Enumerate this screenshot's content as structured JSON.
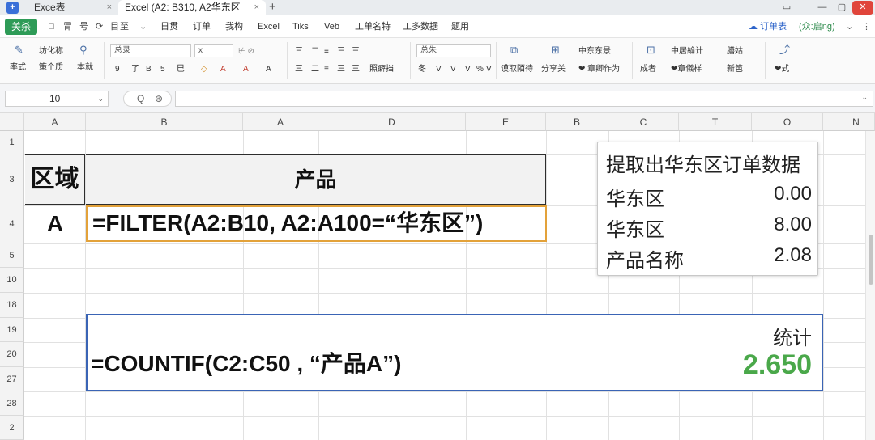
{
  "titlebar": {
    "logo": "+",
    "tabs": [
      {
        "label": "Exce表",
        "close": "×"
      },
      {
        "label": "Excel (A2: B310, A2华东区",
        "close": "×"
      }
    ],
    "new_tab": "+",
    "controls": [
      "▭",
      "—",
      "▢",
      "✕"
    ]
  },
  "menubar": {
    "start_label": "关杀",
    "quick_icons": [
      "□",
      "冐",
      "号",
      "⟳",
      "目",
      "至"
    ],
    "items": [
      "日贯",
      "订单",
      "我构",
      "Excel",
      "Tiks",
      "Veb",
      "工单名特",
      "工多数据",
      "题用"
    ],
    "right_tools": {
      "orders": "订单表",
      "user": "(众:启ng)",
      "more": "⌄",
      "menu": "⋮"
    }
  },
  "ribbon": {
    "group1": {
      "tool1_top": "坊化称",
      "tool1_bottom": "策个质",
      "left_top": "率式",
      "tool2": "本就"
    },
    "font": {
      "name": "总录",
      "size": "x",
      "sizes": [
        "9",
        "了",
        "B",
        "5",
        "巳"
      ],
      "clear": "⊬ ⊘"
    },
    "font_colors": [
      "◇",
      "A",
      "A",
      "A"
    ],
    "align_row1": [
      "三",
      "二",
      "≡",
      "三",
      "三"
    ],
    "align_row2": [
      "三",
      "二",
      "≡",
      "三",
      "三"
    ],
    "wrap": "照癖挡",
    "number": {
      "format": "总朱",
      "tools": [
        "冬",
        "V",
        "V",
        "V",
        "%",
        "V"
      ]
    },
    "extract_label": "谟取陌待",
    "share_label": "分享关",
    "group_label": "中东东景",
    "sub_label": "❤ 章卿作为",
    "insert": {
      "label": "成者",
      "top": "中居綸计",
      "bottom": "❤章儀样"
    },
    "style": {
      "top": "膳姑",
      "bottom": "新笆"
    },
    "last_label": "❤式"
  },
  "formula_bar": {
    "cell_ref": "10",
    "dropdown": "⌄",
    "icons": [
      "Q",
      "⊛"
    ],
    "value": ""
  },
  "grid": {
    "columns": [
      "A",
      "B",
      "A",
      "D",
      "E",
      "B",
      "C",
      "T",
      "O",
      "N"
    ],
    "rows": [
      "1",
      "3",
      "4",
      "5",
      "10",
      "18",
      "19",
      "20",
      "27",
      "28",
      "2"
    ],
    "cells": {
      "region_header": "区域",
      "product_header": "产品",
      "region_value": "A",
      "filter_formula": "=FILTER(A2:B10, A2:A100=“华东区”)",
      "countif_formula": "=COUNTIF(C2:C50 , “产品A”)",
      "stat_label": "统计",
      "stat_value": "2.650"
    },
    "popup": {
      "title": "提取出华东区订单数据",
      "rows": [
        {
          "label": "华东区",
          "value": "0.00"
        },
        {
          "label": "华东区",
          "value": "8.00"
        },
        {
          "label": "产品名称",
          "value": "2.08"
        }
      ]
    }
  },
  "colors": {
    "accent_green": "#2e9b57",
    "formula_orange": "#e3a23a",
    "countif_blue": "#3a64b5",
    "stat_green": "#4aa84a"
  }
}
